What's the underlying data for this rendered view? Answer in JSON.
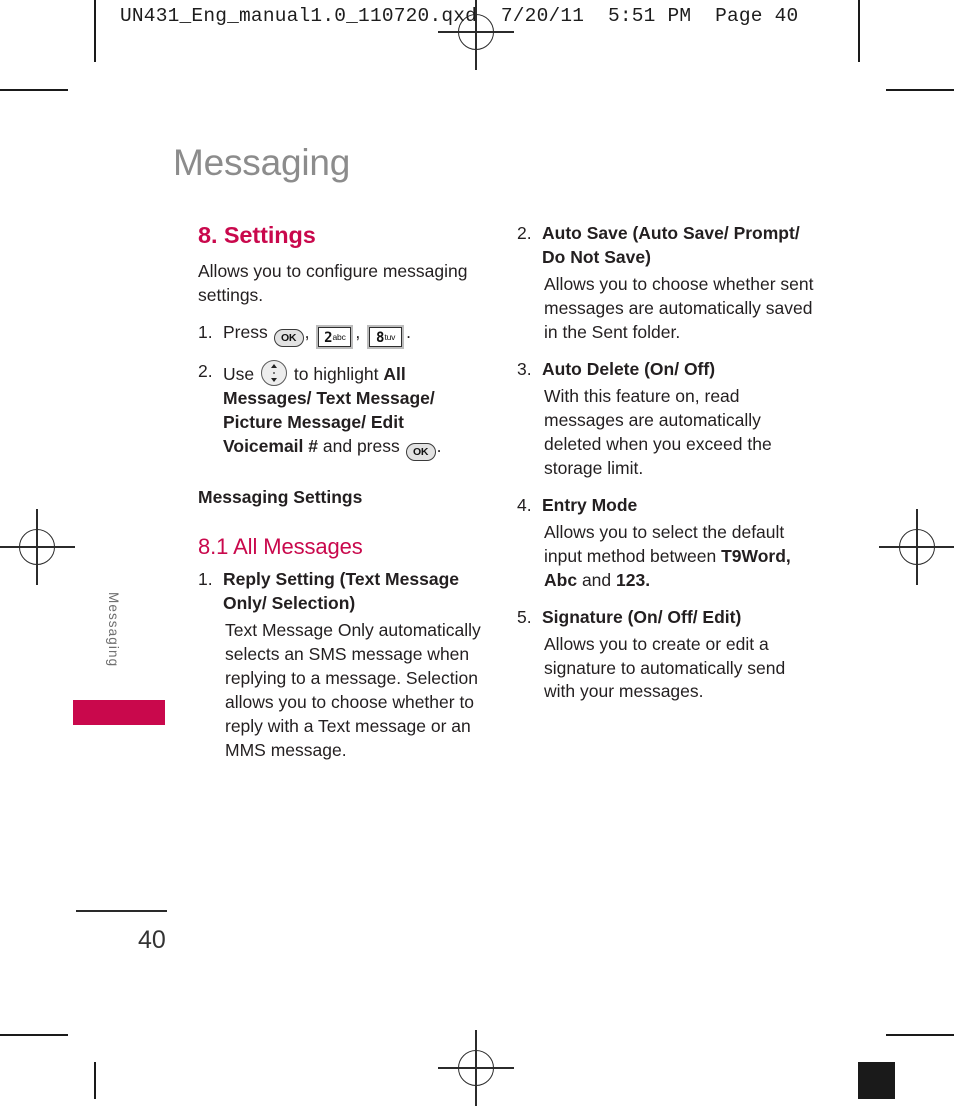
{
  "slug": "UN431_Eng_manual1.0_110720.qxd  7/20/11  5:51 PM  Page 40",
  "page_title": "Messaging",
  "side_tab": {
    "label": "Messaging"
  },
  "page_number": "40",
  "colors": {
    "accent_pink": "#c9084c",
    "title_gray": "#8c8c8c",
    "body_black": "#231f20"
  },
  "icons": {
    "ok_key": "OK",
    "key2_digit": "2",
    "key2_letters": "abc",
    "key8_digit": "8",
    "key8_letters": "tuv"
  },
  "left_column": {
    "heading": "8. Settings",
    "intro": "Allows you to configure messaging settings.",
    "steps": [
      {
        "num": "1.",
        "text_before": "Press",
        "text_mid1": ",",
        "text_mid2": ",",
        "text_after": "."
      },
      {
        "num": "2.",
        "text_before": "Use",
        "text_mid": "to highlight",
        "bold_options": "All Messages/ Text Message/ Picture Message/ Edit Voicemail #",
        "text_tail": "and press",
        "text_end": "."
      }
    ],
    "sub_heading_bold": "Messaging Settings",
    "sub_heading_pink": "8.1 All Messages",
    "items": [
      {
        "num": "1.",
        "title": "Reply Setting (Text Message Only/ Selection)",
        "desc": "Text Message Only automatically selects an SMS message when replying to a message. Selection allows you to choose whether to reply with a Text message or an MMS message."
      }
    ]
  },
  "right_column": {
    "items": [
      {
        "num": "2.",
        "title": "Auto Save (Auto Save/ Prompt/ Do Not Save)",
        "desc": "Allows you to choose whether sent messages are automatically saved in the Sent folder."
      },
      {
        "num": "3.",
        "title": "Auto Delete (On/ Off)",
        "desc": "With this feature on, read messages are automatically deleted when you exceed the storage limit."
      },
      {
        "num": "4.",
        "title": "Entry Mode",
        "desc_pre": "Allows you to select the default input method between",
        "desc_bold1": "T9Word, Abc",
        "desc_mid": "and",
        "desc_bold2": "123",
        "desc_end": "."
      },
      {
        "num": "5.",
        "title": "Signature (On/ Off/ Edit)",
        "desc": "Allows you to create or edit a signature to automatically send with your messages."
      }
    ]
  }
}
